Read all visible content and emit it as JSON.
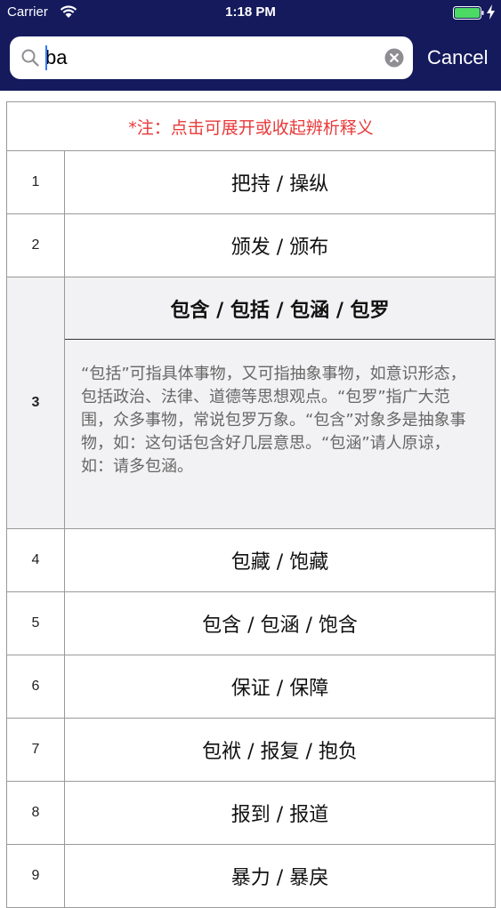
{
  "status_bar": {
    "carrier": "Carrier",
    "time": "1:18 PM",
    "battery_color": "#4cd964"
  },
  "search": {
    "value": "ba",
    "cancel_label": "Cancel"
  },
  "table": {
    "note": "*注：点击可展开或收起辨析释义",
    "note_color": "#e8393a",
    "rows": [
      {
        "num": "1",
        "words": "把持 / 操纵"
      },
      {
        "num": "2",
        "words": "颁发 / 颁布"
      },
      {
        "num": "3",
        "words": "包含 / 包括 / 包涵 / 包罗",
        "explanation": "“包括”可指具体事物，又可指抽象事物，如意识形态，包括政治、法律、道德等思想观点。“包罗”指广大范围，众多事物，常说包罗万象。“包含”对象多是抽象事物，如：这句话包含好几层意思。“包涵”请人原谅，如：请多包涵。"
      },
      {
        "num": "4",
        "words": "包藏 / 饱藏"
      },
      {
        "num": "5",
        "words": "包含 / 包涵 / 饱含"
      },
      {
        "num": "6",
        "words": "保证 / 保障"
      },
      {
        "num": "7",
        "words": "包袱 / 报复 / 抱负"
      },
      {
        "num": "8",
        "words": "报到 / 报道"
      },
      {
        "num": "9",
        "words": "暴力 / 暴戾"
      }
    ]
  }
}
